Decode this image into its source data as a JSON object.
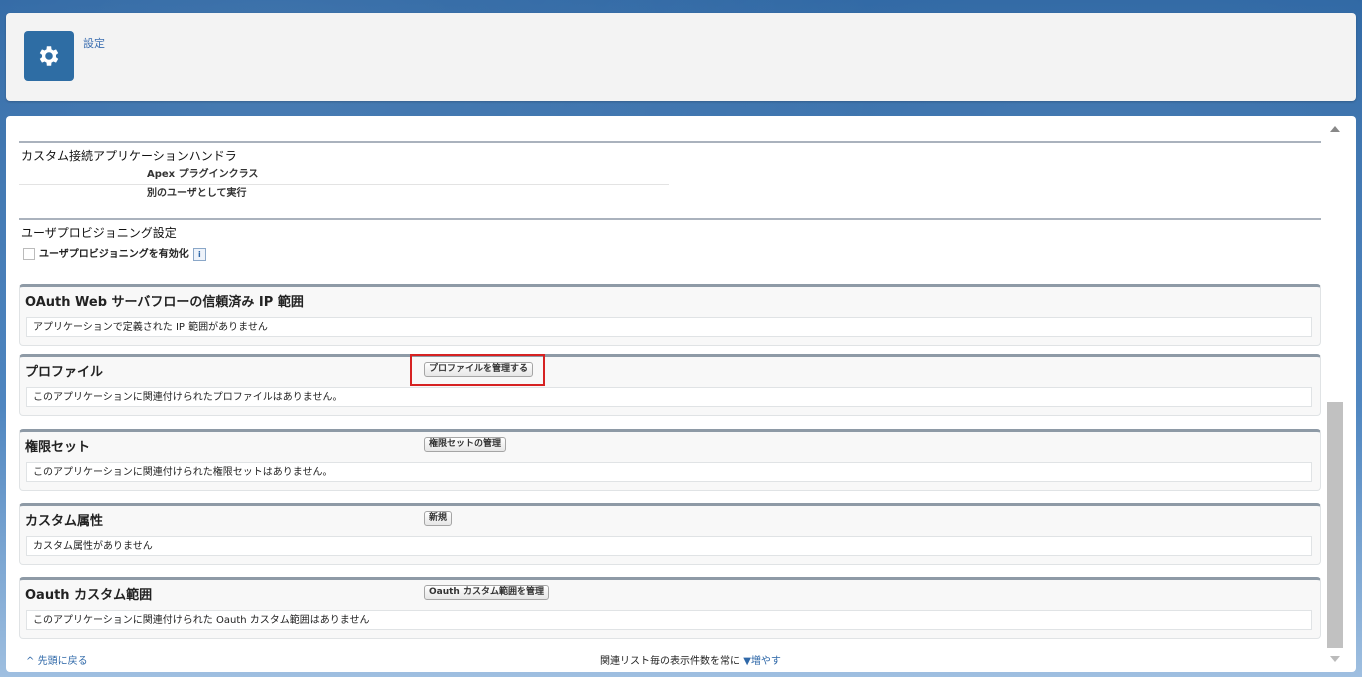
{
  "header": {
    "title": "設定",
    "icon": "gear-icon"
  },
  "connected_app_handler": {
    "title": "カスタム接続アプリケーションハンドラ",
    "rows": [
      "Apex プラグインクラス",
      "別のユーザとして実行"
    ]
  },
  "user_provisioning": {
    "title": "ユーザプロビジョニング設定",
    "checkbox_label": "ユーザプロビジョニングを有効化"
  },
  "oauth_ip": {
    "title": "OAuth Web サーバフローの信頼済み IP 範囲",
    "empty_text": "アプリケーションで定義された IP 範囲がありません"
  },
  "profiles": {
    "title": "プロファイル",
    "button": "プロファイルを管理する",
    "empty_text": "このアプリケーションに関連付けられたプロファイルはありません。"
  },
  "permission_sets": {
    "title": "権限セット",
    "button": "権限セットの管理",
    "empty_text": "このアプリケーションに関連付けられた権限セットはありません。"
  },
  "custom_attributes": {
    "title": "カスタム属性",
    "button": "新規",
    "empty_text": "カスタム属性がありません"
  },
  "oauth_scopes": {
    "title": "Oauth カスタム範囲",
    "button": "Oauth カスタム範囲を管理",
    "empty_text": "このアプリケーションに関連付けられた Oauth カスタム範囲はありません"
  },
  "footer": {
    "back_to_top": "先頭に戻る",
    "related_list_text": "関連リスト毎の表示件数を常に",
    "increase_link": "増やす"
  },
  "colors": {
    "accent": "#2e6da4",
    "highlight": "#d62222"
  }
}
